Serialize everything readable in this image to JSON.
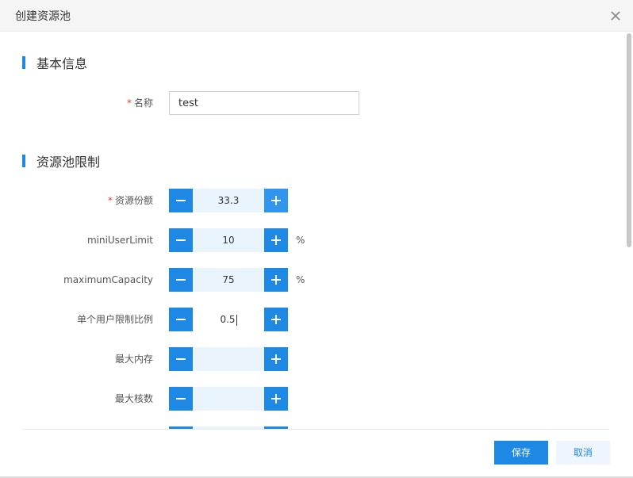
{
  "dialog": {
    "title": "创建资源池"
  },
  "sections": {
    "basic": "基本信息",
    "limits": "资源池限制"
  },
  "fields": {
    "name": {
      "label": "名称",
      "value": "test",
      "required": true
    },
    "quota": {
      "label": "资源份额",
      "value": "33.3",
      "required": true
    },
    "mini_user_limit": {
      "label": "miniUserLimit",
      "value": "10",
      "unit": "%"
    },
    "maximum_capacity": {
      "label": "maximumCapacity",
      "value": "75",
      "unit": "%"
    },
    "user_limit_ratio": {
      "label": "单个用户限制比例",
      "value": "0.5"
    },
    "max_memory": {
      "label": "最大内存",
      "value": ""
    },
    "max_cores": {
      "label": "最大核数",
      "value": ""
    }
  },
  "required_mark": "*",
  "footer": {
    "save": "保存",
    "cancel": "取消"
  },
  "colors": {
    "accent": "#1e88e5",
    "required": "#e53935",
    "stepper_bg": "#eaf4fd"
  },
  "icons": {
    "close": "close-icon",
    "minus": "minus-icon",
    "plus": "plus-icon"
  }
}
